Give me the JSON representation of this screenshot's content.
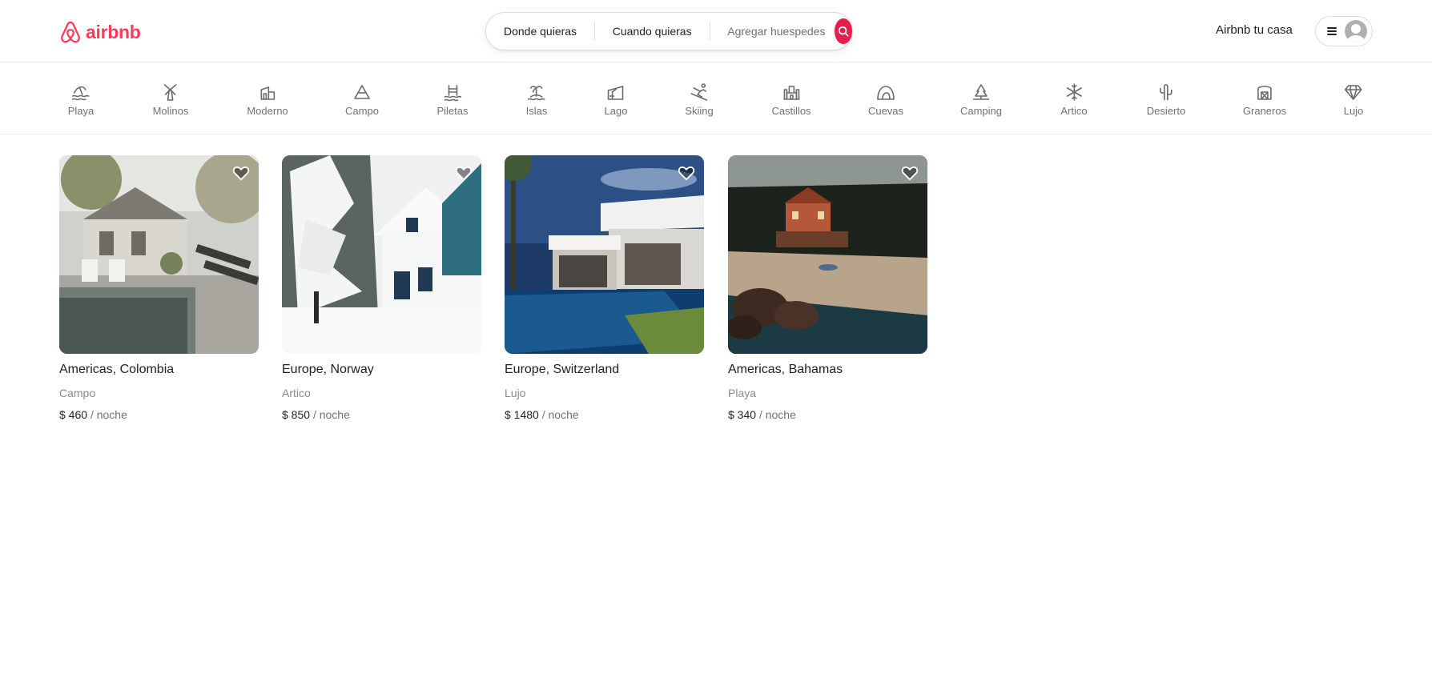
{
  "brand": {
    "name": "airbnb",
    "color": "#ff385c"
  },
  "search": {
    "where": "Donde quieras",
    "when": "Cuando quieras",
    "guests": "Agregar huespedes",
    "button_icon": "search-icon"
  },
  "header": {
    "host_link": "Airbnb tu casa",
    "menu_icon": "hamburger-icon",
    "avatar_icon": "user-avatar-icon"
  },
  "categories": [
    {
      "label": "Playa",
      "icon": "beach-icon"
    },
    {
      "label": "Molinos",
      "icon": "windmill-icon"
    },
    {
      "label": "Moderno",
      "icon": "modern-house-icon"
    },
    {
      "label": "Campo",
      "icon": "countryside-icon"
    },
    {
      "label": "Piletas",
      "icon": "pool-icon"
    },
    {
      "label": "Islas",
      "icon": "island-icon"
    },
    {
      "label": "Lago",
      "icon": "lake-icon"
    },
    {
      "label": "Skiing",
      "icon": "skiing-icon"
    },
    {
      "label": "Castillos",
      "icon": "castle-icon"
    },
    {
      "label": "Cuevas",
      "icon": "cave-icon"
    },
    {
      "label": "Camping",
      "icon": "camping-icon"
    },
    {
      "label": "Artico",
      "icon": "snowflake-icon"
    },
    {
      "label": "Desierto",
      "icon": "cactus-icon"
    },
    {
      "label": "Graneros",
      "icon": "barn-icon"
    },
    {
      "label": "Lujo",
      "icon": "diamond-icon"
    }
  ],
  "listings": [
    {
      "title": "Americas, Colombia",
      "category": "Campo",
      "price": "$ 460",
      "per": "/ noche"
    },
    {
      "title": "Europe, Norway",
      "category": "Artico",
      "price": "$ 850",
      "per": "/ noche"
    },
    {
      "title": "Europe, Switzerland",
      "category": "Lujo",
      "price": "$ 1480",
      "per": "/ noche"
    },
    {
      "title": "Americas, Bahamas",
      "category": "Playa",
      "price": "$ 340",
      "per": "/ noche"
    }
  ]
}
